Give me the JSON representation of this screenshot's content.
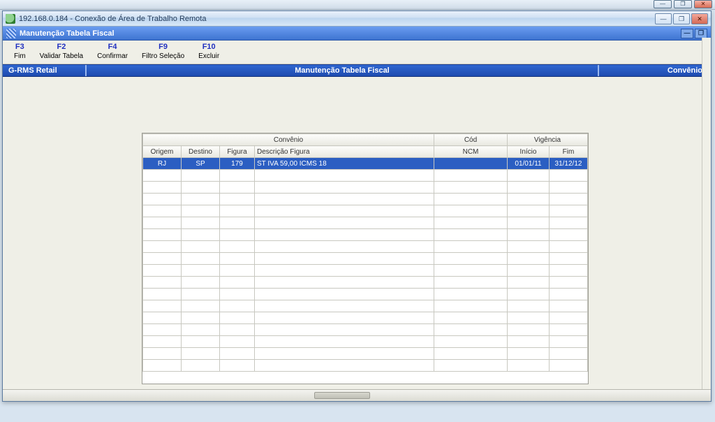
{
  "os": {
    "truncated_bg_title": "",
    "minimize": "—",
    "maximize": "❐",
    "close": "✕"
  },
  "rdp": {
    "title": "192.168.0.184 - Conexão de Área de Trabalho Remota",
    "minimize": "—",
    "maximize": "❐",
    "close": "✕"
  },
  "app": {
    "title": "Manutenção Tabela Fiscal",
    "minimize": "—",
    "restore": "❐"
  },
  "fkeys": [
    {
      "key": "F3",
      "label": "Fim"
    },
    {
      "key": "F2",
      "label": "Validar Tabela"
    },
    {
      "key": "F4",
      "label": "Confirmar"
    },
    {
      "key": "F9",
      "label": "Filtro Seleção"
    },
    {
      "key": "F10",
      "label": "Excluir"
    }
  ],
  "bluebar": {
    "left": "G-RMS Retail",
    "mid": "Manutenção Tabela Fiscal",
    "right": "Convênio"
  },
  "grid": {
    "group_headers": {
      "convenio": "Convênio",
      "cod": "Cód",
      "vigencia": "Vigência"
    },
    "columns": {
      "origem": "Origem",
      "destino": "Destino",
      "figura": "Figura",
      "descricao": "Descrição Figura",
      "ncm": "NCM",
      "inicio": "Início",
      "fim": "Fim"
    },
    "rows": [
      {
        "origem": "RJ",
        "destino": "SP",
        "figura": "179",
        "descricao": "ST IVA 59,00 ICMS 18",
        "ncm": "",
        "inicio": "01/01/11",
        "fim": "31/12/12"
      }
    ]
  }
}
